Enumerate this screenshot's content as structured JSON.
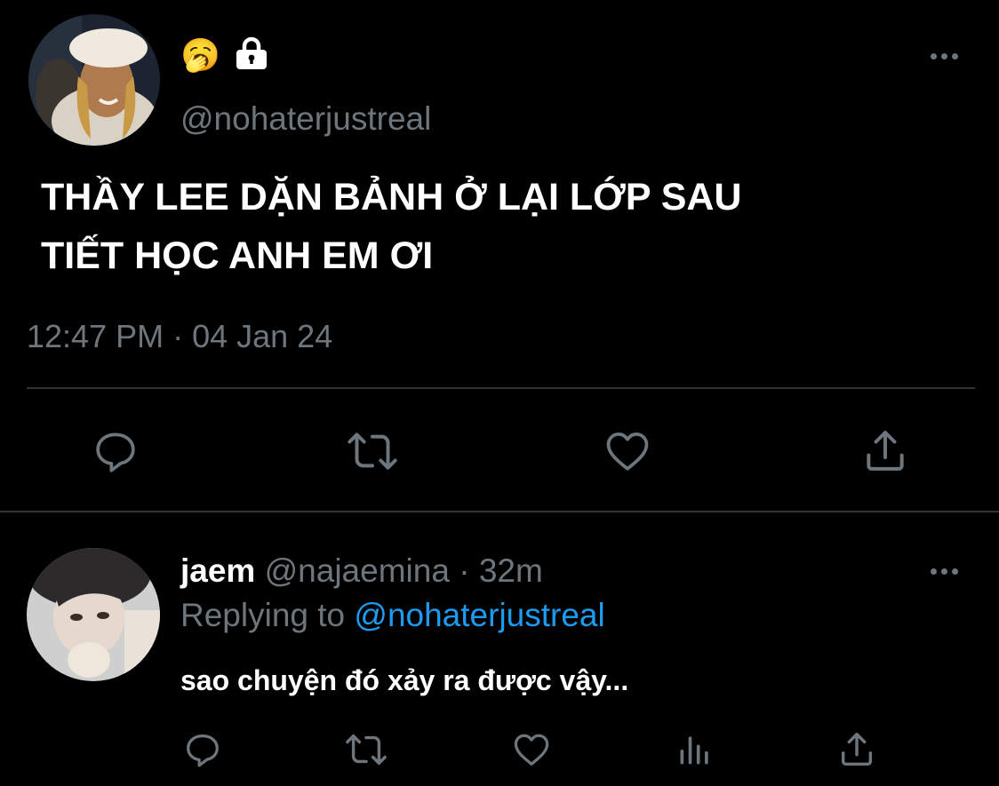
{
  "main_tweet": {
    "handle": "@nohaterjustreal",
    "display_emoji": "🥱",
    "text_line1": "THẦY LEE DẶN BẢNH Ở LẠI LỚP SAU",
    "text_line2": "TIẾT HỌC ANH EM ƠI",
    "timestamp": "12:47 PM · 04 Jan 24",
    "icons": [
      "reply-icon",
      "retweet-icon",
      "like-icon",
      "share-icon",
      "lock-icon",
      "more-icon"
    ]
  },
  "reply": {
    "name": "jaem",
    "handle": "@najaemina",
    "separator": "·",
    "age": "32m",
    "replying_prefix": "Replying to",
    "replying_to": "@nohaterjustreal",
    "text": "sao chuyện đó xảy ra được vậy...",
    "icons": [
      "reply-icon",
      "retweet-icon",
      "like-icon",
      "views-icon",
      "share-icon",
      "more-icon"
    ]
  },
  "colors": {
    "background": "#000000",
    "muted": "#6e767d",
    "link": "#1d9bf0",
    "divider": "#2f3336"
  }
}
